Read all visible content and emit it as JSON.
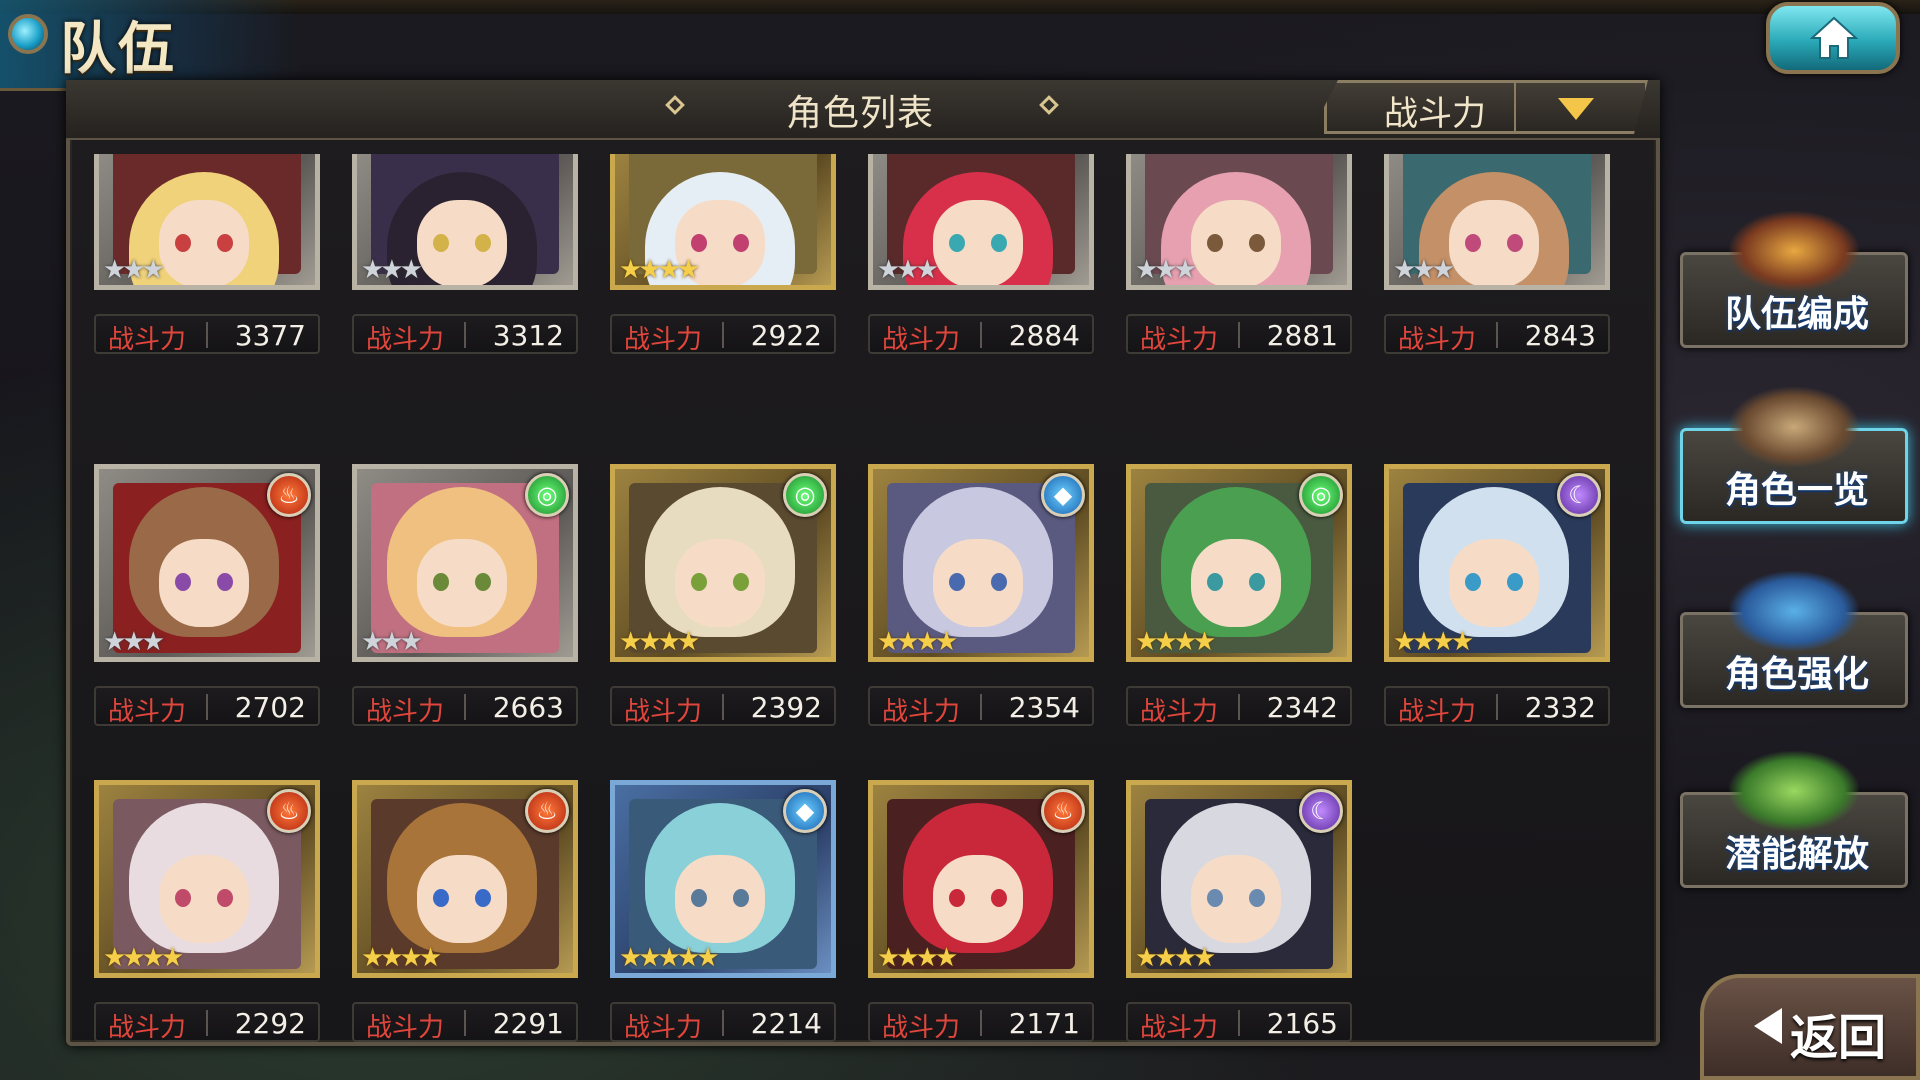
{
  "header": {
    "title": "队伍"
  },
  "panel": {
    "title": "角色列表"
  },
  "sort": {
    "label": "战斗力"
  },
  "power_label": "战斗力",
  "characters": [
    {
      "power": "3377",
      "rarity": 3,
      "element": "",
      "frame": "silver",
      "colors": [
        "#6b2a2a",
        "#f0d27a",
        "#c94040"
      ]
    },
    {
      "power": "3312",
      "rarity": 3,
      "element": "",
      "frame": "silver",
      "colors": [
        "#3a2f4a",
        "#2a2230",
        "#d4b24a"
      ]
    },
    {
      "power": "2922",
      "rarity": 4,
      "element": "",
      "frame": "gold",
      "colors": [
        "#7a6a3a",
        "#e6eef5",
        "#c24070"
      ]
    },
    {
      "power": "2884",
      "rarity": 3,
      "element": "",
      "frame": "silver",
      "colors": [
        "#5a2a2a",
        "#d8304a",
        "#3aa8b0"
      ]
    },
    {
      "power": "2881",
      "rarity": 3,
      "element": "",
      "frame": "silver",
      "colors": [
        "#6a4a50",
        "#e6a0b0",
        "#7a5a3a"
      ]
    },
    {
      "power": "2843",
      "rarity": 3,
      "element": "",
      "frame": "silver",
      "colors": [
        "#3a6a70",
        "#c49068",
        "#c04a7a"
      ]
    },
    {
      "power": "2702",
      "rarity": 3,
      "element": "fire",
      "frame": "silver",
      "colors": [
        "#8a2020",
        "#9a6a48",
        "#8a4aa8"
      ]
    },
    {
      "power": "2663",
      "rarity": 3,
      "element": "wind",
      "frame": "silver",
      "colors": [
        "#c07080",
        "#f0c080",
        "#6a8a3a"
      ]
    },
    {
      "power": "2392",
      "rarity": 4,
      "element": "wind",
      "frame": "gold",
      "colors": [
        "#5a4a30",
        "#e8dcc0",
        "#7aa03a"
      ]
    },
    {
      "power": "2354",
      "rarity": 4,
      "element": "water",
      "frame": "gold",
      "colors": [
        "#5a5a80",
        "#c8c8e0",
        "#4a6ab0"
      ]
    },
    {
      "power": "2342",
      "rarity": 4,
      "element": "wind",
      "frame": "gold",
      "colors": [
        "#4a5a40",
        "#4aa050",
        "#3a9aa0"
      ]
    },
    {
      "power": "2332",
      "rarity": 4,
      "element": "dark",
      "frame": "gold",
      "colors": [
        "#2a3a5a",
        "#d0e0ee",
        "#3a9ac8"
      ]
    },
    {
      "power": "2292",
      "rarity": 4,
      "element": "fire",
      "frame": "gold",
      "colors": [
        "#7a5a60",
        "#e8dce0",
        "#c04a6a"
      ]
    },
    {
      "power": "2291",
      "rarity": 4,
      "element": "fire",
      "frame": "gold",
      "colors": [
        "#5a3a2a",
        "#a8743a",
        "#3a6ac8"
      ]
    },
    {
      "power": "2214",
      "rarity": 5,
      "element": "water",
      "frame": "blue",
      "colors": [
        "#3a5a7a",
        "#8ad0d8",
        "#5a7a9a"
      ]
    },
    {
      "power": "2171",
      "rarity": 4,
      "element": "fire",
      "frame": "gold",
      "colors": [
        "#4a2020",
        "#c8283a",
        "#c8283a"
      ]
    },
    {
      "power": "2165",
      "rarity": 4,
      "element": "dark",
      "frame": "gold",
      "colors": [
        "#2a2a3a",
        "#d8d8e0",
        "#6a8ab0"
      ]
    }
  ],
  "side_menu": [
    {
      "label": "队伍编成",
      "active": false
    },
    {
      "label": "角色一览",
      "active": true
    },
    {
      "label": "角色强化",
      "active": false
    },
    {
      "label": "潜能解放",
      "active": false
    }
  ],
  "back": {
    "label": "返回"
  }
}
